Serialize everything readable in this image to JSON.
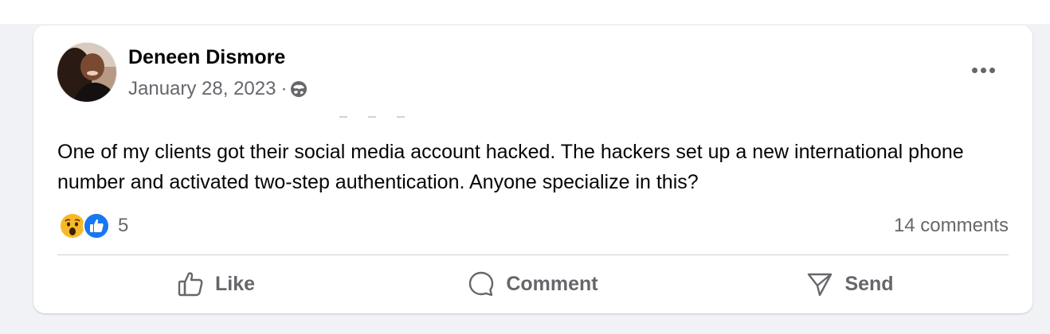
{
  "post": {
    "author": "Deneen Dismore",
    "date": "January 28, 2023",
    "separator": "·",
    "audience_icon": "globe-icon",
    "text": "One of my clients got their social media account hacked. The hackers set up a new international phone number and activated two-step authentication. Anyone specialize in this?"
  },
  "reactions": {
    "icons": [
      "wow-reaction-icon",
      "like-reaction-icon"
    ],
    "count": "5"
  },
  "comments_count": "14 comments",
  "actions": {
    "like": "Like",
    "comment": "Comment",
    "send": "Send"
  },
  "colors": {
    "background": "#f0f2f5",
    "card": "#ffffff",
    "secondary_text": "#65676b",
    "like_blue": "#1877f2",
    "wow_yellow": "#f7b928"
  }
}
